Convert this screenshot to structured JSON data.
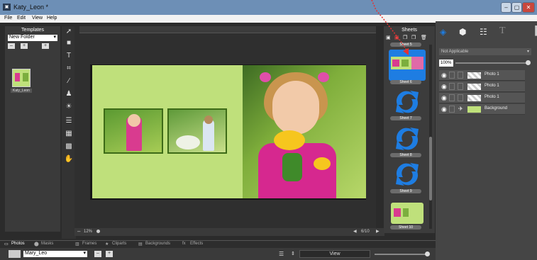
{
  "window": {
    "title": "Katy_Leon *",
    "app_icon": "app-icon",
    "controls": [
      "–",
      "▢",
      "✕"
    ]
  },
  "menu": [
    "File",
    "Edit",
    "View",
    "Help"
  ],
  "templates": {
    "header": "Templates",
    "folder_select": "New Folder",
    "item_label": "Katy_Leon"
  },
  "tools": [
    "arrow-tool-icon",
    "rectangle-tool-icon",
    "text-tool-icon",
    "crop-tool-icon",
    "pen-tool-icon",
    "stamp-tool-icon",
    "light-tool-icon",
    "list-tool-icon",
    "grid-tool-icon",
    "grid-add-tool-icon",
    "hand-tool-icon"
  ],
  "canvas": {
    "zoom": "12%",
    "page_counter": "6/10"
  },
  "sheets": {
    "header": "Sheets",
    "items": [
      {
        "label": "Sheet 5",
        "kind": "header"
      },
      {
        "label": "Sheet 6",
        "kind": "photos",
        "selected": true
      },
      {
        "label": "Sheet 7",
        "kind": "arrows"
      },
      {
        "label": "Sheet 8",
        "kind": "arrows"
      },
      {
        "label": "Sheet 9",
        "kind": "arrows"
      },
      {
        "label": "Sheet 10",
        "kind": "photos"
      }
    ]
  },
  "properties": {
    "select_value": "Not Applicable",
    "opacity": "100%",
    "layers": [
      {
        "name": "Photo 1"
      },
      {
        "name": "Photo 1"
      },
      {
        "name": "Photo 1"
      },
      {
        "name": "Background"
      }
    ]
  },
  "bottom_tabs": [
    "Photos",
    "Masks",
    "Frames",
    "Cliparts",
    "Backgrounds",
    "Effects"
  ],
  "bottom_bar": {
    "album_select": "Mary_Leo",
    "view_label": "View"
  },
  "colors": {
    "accent": "#1e7de2",
    "page_green": "#bfe07b"
  }
}
